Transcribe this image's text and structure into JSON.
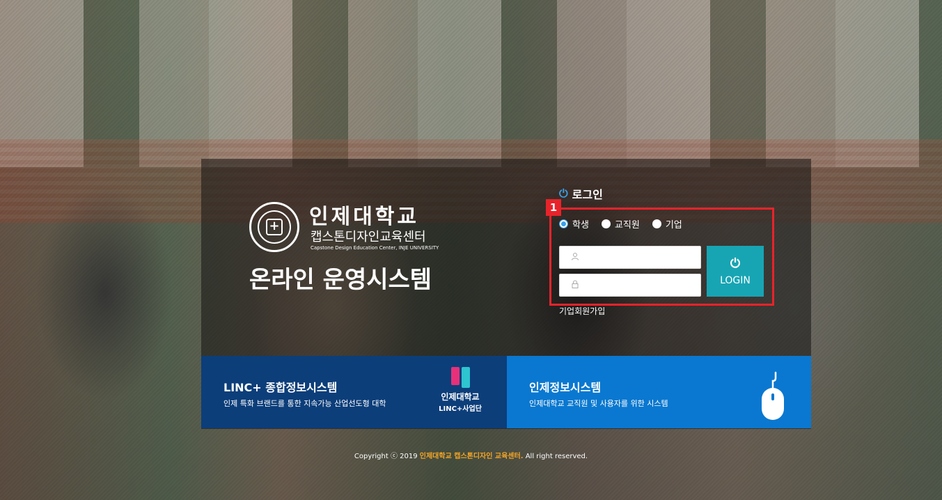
{
  "logo": {
    "university": "인제대학교",
    "center": "캡스톤디자인교육센터",
    "center_en": "Capstone Design Education Center, INJE UNIVERSITY",
    "system_title": "온라인 운영시스템"
  },
  "login": {
    "heading": "로그인",
    "badge": "1",
    "user_types": [
      {
        "label": "학생",
        "checked": true
      },
      {
        "label": "교직원",
        "checked": false
      },
      {
        "label": "기업",
        "checked": false
      }
    ],
    "id_placeholder": "",
    "pw_placeholder": "",
    "button_label": "LOGIN",
    "join_link": "기업회원가입"
  },
  "banners": {
    "linc": {
      "title": "LINC+ 종합정보시스템",
      "desc": "인제 특화 브랜드를 통한 지속가능 산업선도형 대학",
      "logo_line1": "인제대학교",
      "logo_line2": "LINC+사업단"
    },
    "inje": {
      "title": "인제정보시스템",
      "desc": "인제대학교 교직원 및 사용자를 위한 시스템"
    }
  },
  "footer": {
    "prefix": "Copyright ⓒ 2019 ",
    "brand": "인제대학교 캡스톤디자인 교육센터.",
    "suffix": " All right reserved."
  },
  "colors": {
    "accent_teal": "#17a5b4",
    "highlight_red": "#e8232a",
    "banner_linc": "#0c3e7a",
    "banner_inje": "#0a78d0",
    "footer_brand": "#f4a526"
  }
}
